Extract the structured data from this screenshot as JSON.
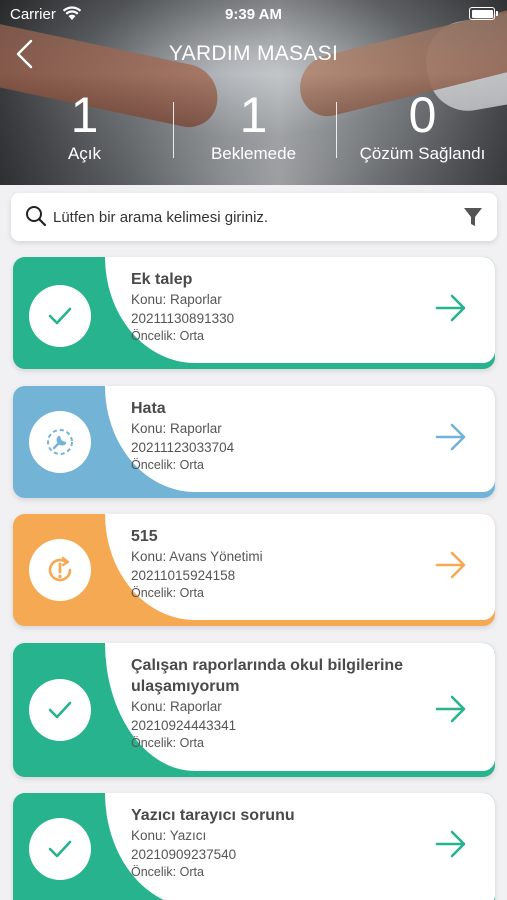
{
  "status_bar": {
    "carrier": "Carrier",
    "time": "9:39 AM"
  },
  "header": {
    "title": "YARDIM MASASI",
    "stats": [
      {
        "count": "1",
        "label": "Açık"
      },
      {
        "count": "1",
        "label": "Beklemede"
      },
      {
        "count": "0",
        "label": "Çözüm Sağlandı"
      }
    ]
  },
  "search": {
    "placeholder": "Lütfen bir arama kelimesi giriniz."
  },
  "colors": {
    "resolved": "#26b38e",
    "bug": "#73b3d6",
    "pending": "#f5a952"
  },
  "tickets": [
    {
      "title": "Ek talep",
      "subject": "Konu: Raporlar",
      "number": "20211130891330",
      "priority": "Öncelik: Orta",
      "icon": "check-icon"
    },
    {
      "title": "Hata",
      "subject": "Konu: Raporlar",
      "number": "20211123033704",
      "priority": "Öncelik: Orta",
      "icon": "wrench-icon"
    },
    {
      "title": "515",
      "subject": "Konu: Avans Yönetimi",
      "number": "20211015924158",
      "priority": "Öncelik: Orta",
      "icon": "alert-refresh-icon"
    },
    {
      "title": "Çalışan raporlarında okul bilgilerine ulaşamıyorum",
      "subject": "Konu: Raporlar",
      "number": "20210924443341",
      "priority": "Öncelik: Orta",
      "icon": "check-icon"
    },
    {
      "title": "Yazıcı tarayıcı sorunu",
      "subject": "Konu: Yazıcı",
      "number": "20210909237540",
      "priority": "Öncelik: Orta",
      "icon": "check-icon"
    }
  ]
}
